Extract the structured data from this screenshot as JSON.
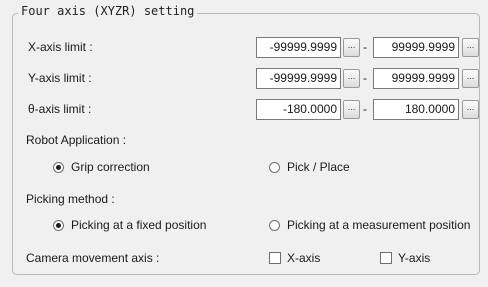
{
  "group": {
    "title": "Four axis (XYZR) setting"
  },
  "limits": [
    {
      "label": "X-axis limit :",
      "min": "-99999.9999",
      "max": "99999.9999",
      "min_button": "...",
      "max_button": "...",
      "separator": "-"
    },
    {
      "label": "Y-axis limit :",
      "min": "-99999.9999",
      "max": "99999.9999",
      "min_button": "...",
      "max_button": "...",
      "separator": "-"
    },
    {
      "label": "θ-axis limit :",
      "min": "-180.0000",
      "max": "180.0000",
      "min_button": "...",
      "max_button": "...",
      "separator": "-"
    }
  ],
  "robot_application": {
    "label": "Robot Application :",
    "options": [
      {
        "label": "Grip correction",
        "selected": true
      },
      {
        "label": "Pick / Place",
        "selected": false
      }
    ]
  },
  "picking_method": {
    "label": "Picking method :",
    "options": [
      {
        "label": "Picking at a fixed position",
        "selected": true
      },
      {
        "label": "Picking at a measurement position",
        "selected": false
      }
    ]
  },
  "camera_movement_axis": {
    "label": "Camera movement axis :",
    "options": [
      {
        "label": "X-axis",
        "checked": false
      },
      {
        "label": "Y-axis",
        "checked": false
      }
    ]
  }
}
